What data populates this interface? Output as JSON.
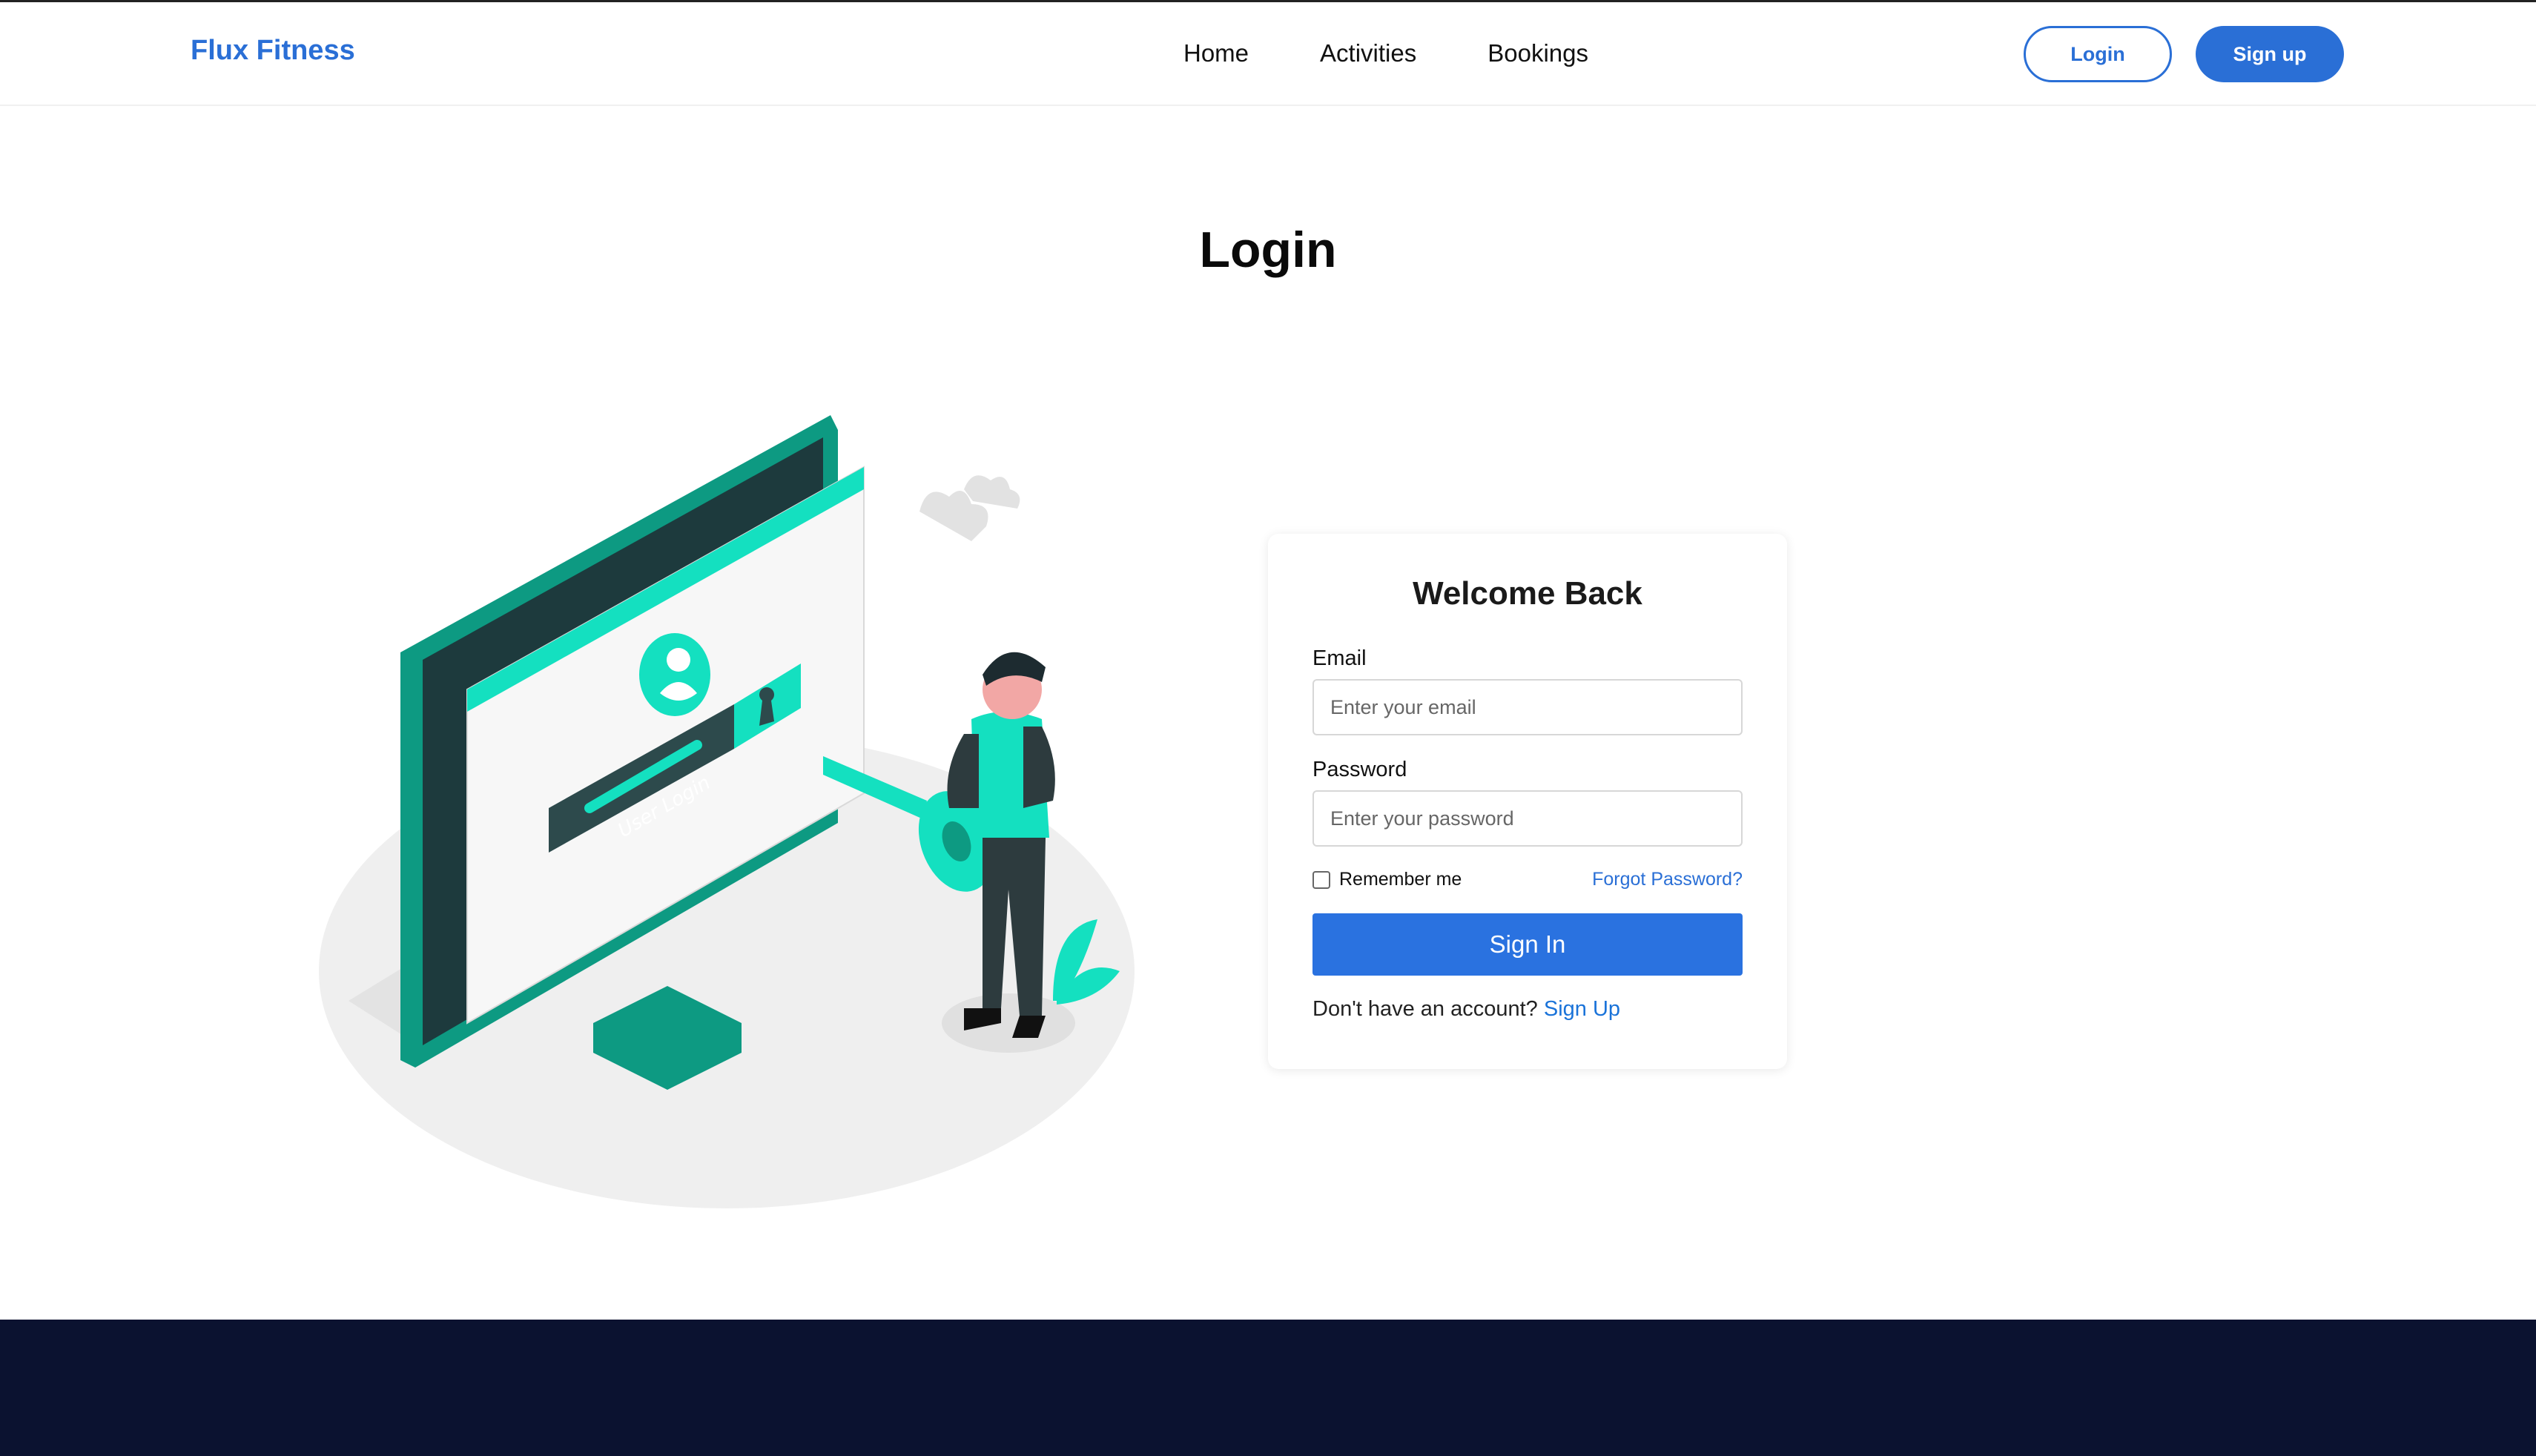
{
  "brand": {
    "name": "Flux Fitness"
  },
  "nav": {
    "items": [
      "Home",
      "Activities",
      "Bookings"
    ]
  },
  "header": {
    "login_label": "Login",
    "signup_label": "Sign up"
  },
  "page": {
    "title": "Login"
  },
  "illustration": {
    "screen_text": "User Login"
  },
  "form": {
    "heading": "Welcome Back",
    "email_label": "Email",
    "email_placeholder": "Enter your email",
    "password_label": "Password",
    "password_placeholder": "Enter your password",
    "remember_label": "Remember me",
    "forgot_label": "Forgot Password?",
    "submit_label": "Sign In",
    "no_account_text": "Don't have an account?",
    "signup_link": "Sign Up"
  },
  "colors": {
    "accent": "#2a6fd6",
    "footer": "#0b1230",
    "teal": "#14e0c0"
  }
}
